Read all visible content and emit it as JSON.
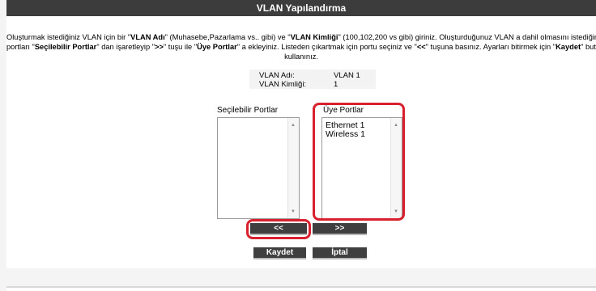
{
  "title": "VLAN Yapılandırma",
  "instructions": {
    "line1_parts": [
      {
        "t": "Oluşturmak istediğiniz VLAN için bir \"",
        "b": false
      },
      {
        "t": "VLAN Adı",
        "b": true
      },
      {
        "t": "\" (Muhasebe,Pazarlama vs.. gibi) ve \"",
        "b": false
      },
      {
        "t": "VLAN Kimliği",
        "b": true
      },
      {
        "t": "\" (100,102,200 vs gibi) giriniz. Oluşturduğunuz VLAN a dahil olmasını istediğiniz",
        "b": false
      }
    ],
    "line2_parts": [
      {
        "t": "portları \"",
        "b": false
      },
      {
        "t": "Seçilebilir Portlar",
        "b": true
      },
      {
        "t": "\" dan işaretleyip \"",
        "b": false
      },
      {
        "t": ">>",
        "b": true
      },
      {
        "t": "\" tuşu ile \"",
        "b": false
      },
      {
        "t": "Üye Portlar",
        "b": true
      },
      {
        "t": "\" a ekleyiniz. Listeden çıkartmak için portu seçiniz ve \"",
        "b": false
      },
      {
        "t": "<<",
        "b": true
      },
      {
        "t": "\" tuşuna basınız. Ayarları bitirmek için \"",
        "b": false
      },
      {
        "t": "Kaydet",
        "b": true
      },
      {
        "t": "\" butonuna",
        "b": false
      }
    ],
    "line3": "kullanınız."
  },
  "vlan": {
    "name_label": "VLAN Adı:",
    "name_value": "VLAN 1",
    "id_label": "VLAN Kimliği:",
    "id_value": "1"
  },
  "available_ports": {
    "label": "Seçilebilir Portlar",
    "items": []
  },
  "member_ports": {
    "label": "Üye Portlar",
    "items": [
      "Ethernet 1",
      "Wireless 1"
    ]
  },
  "buttons": {
    "remove": "<<",
    "add": ">>",
    "save": "Kaydet",
    "cancel": "İptal"
  },
  "colors": {
    "title_bar": "#3c3c3c",
    "highlight": "#d9202e",
    "button": "#3f3f3f"
  }
}
